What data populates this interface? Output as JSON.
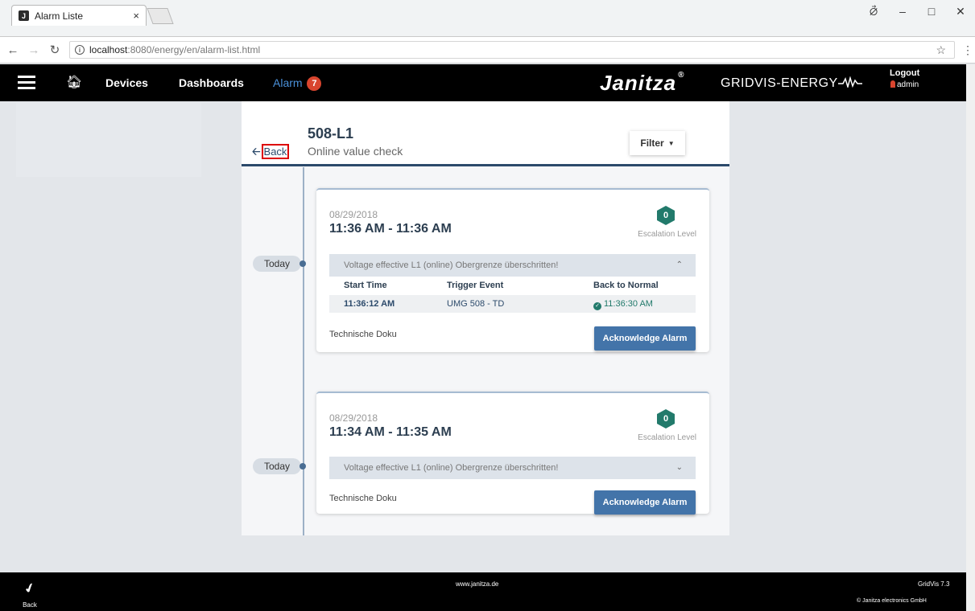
{
  "browser": {
    "tab_title": "Alarm Liste",
    "tab_favicon": "J",
    "tab_close": "×",
    "url_host": "localhost",
    "url_path": ":8080/energy/en/alarm-list.html",
    "window_controls": [
      "⦳",
      "–",
      "□",
      "✕"
    ]
  },
  "nav": {
    "devices": "Devices",
    "dashboards": "Dashboards",
    "alarm": "Alarm",
    "alarm_count": "7",
    "brand": "Janitza",
    "brand_reg": "®",
    "brand_sub": "GRIDVIS-ENERGY",
    "logout": "Logout",
    "user": "admin"
  },
  "page": {
    "back_label": "Back",
    "device_name": "508-L1",
    "subtitle": "Online value check",
    "filter_label": "Filter"
  },
  "alarms": [
    {
      "timeline_label": "Today",
      "date": "08/29/2018",
      "time_range": "11:36 AM - 11:36 AM",
      "escalation_level": "0",
      "escalation_label": "Escalation Level",
      "condition": "Voltage effective L1 (online) Obergrenze überschritten!",
      "expanded": true,
      "columns": [
        "Start Time",
        "Trigger Event",
        "Back to Normal"
      ],
      "row": {
        "start": "11:36:12 AM",
        "trigger": "UMG 508 - TD",
        "normal": "11:36:30 AM"
      },
      "note": "Technische Doku",
      "ack_label": "Acknowledge Alarm"
    },
    {
      "timeline_label": "Today",
      "date": "08/29/2018",
      "time_range": "11:34 AM - 11:35 AM",
      "escalation_level": "0",
      "escalation_label": "Escalation Level",
      "condition": "Voltage effective L1 (online) Obergrenze überschritten!",
      "expanded": false,
      "note": "Technische Doku",
      "ack_label": "Acknowledge Alarm"
    }
  ],
  "footer": {
    "back_label": "Back",
    "website": "www.janitza.de",
    "version": "GridVis 7.3",
    "copyright": "© Janitza electronics GmbH"
  },
  "colors": {
    "nav_bg": "#000000",
    "accent_blue": "#2c4a6b",
    "button_blue": "#4374a9",
    "escalation_green": "#227a6b",
    "alarm_badge": "#d9452e"
  }
}
